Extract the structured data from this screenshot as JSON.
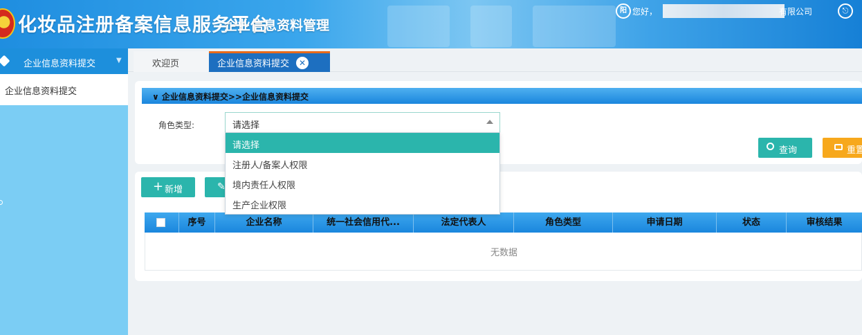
{
  "header": {
    "app_title": "化妆品注册备案信息服务平台",
    "app_subtitle": "企业信息资料管理",
    "greeting": "您好，",
    "company_suffix": "有限公司",
    "user_icon_label": "阳",
    "exit_icon_label": "⎋"
  },
  "sidebar": {
    "group_label": "企业信息资料提交",
    "items": [
      {
        "label": "企业信息资料提交"
      }
    ]
  },
  "tabs": [
    {
      "label": "欢迎页",
      "active": false
    },
    {
      "label": "企业信息资料提交",
      "active": true,
      "close_icon": "✕"
    }
  ],
  "search_panel": {
    "title": "企业信息资料提交>>企业信息资料提交",
    "field_label": "角色类型:",
    "select_value": "请选择",
    "options": [
      "请选择",
      "注册人/备案人权限",
      "境内责任人权限",
      "生产企业权限"
    ],
    "query_label": "查询",
    "reset_label": "重置"
  },
  "toolbar": {
    "add_label": "新增",
    "add_icon": "+"
  },
  "table": {
    "columns": [
      "",
      "序号",
      "企业名称",
      "统一社会信用代...",
      "法定代表人",
      "角色类型",
      "申请日期",
      "状态",
      "审核结果"
    ],
    "rows": [],
    "empty_text": "无数据"
  },
  "colors": {
    "primary": "#1d8fdc",
    "teal": "#2bb5ac",
    "orange": "#f7a81c",
    "sidebar_bg": "#7bcdf4"
  }
}
